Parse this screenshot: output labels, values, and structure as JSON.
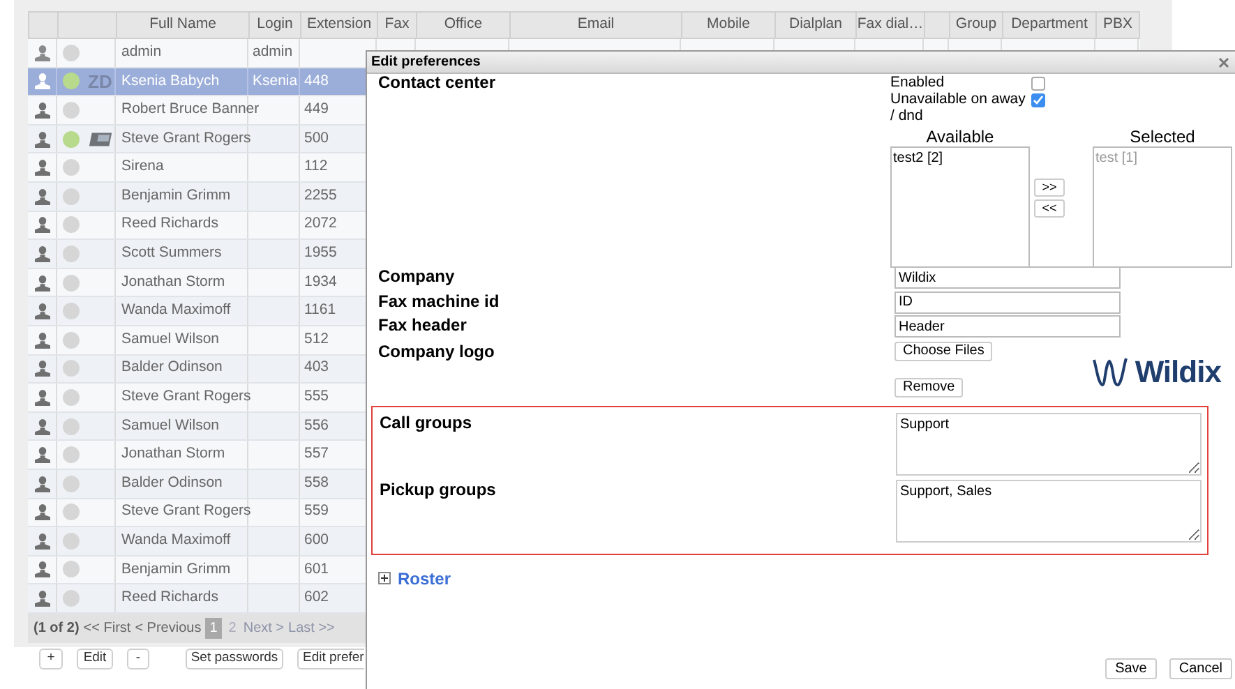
{
  "table": {
    "columns": [
      {
        "kind": "blank"
      },
      {
        "kind": "blank"
      },
      {
        "kind": "text",
        "label": "Full Name"
      },
      {
        "kind": "text",
        "label": "Login"
      },
      {
        "kind": "text",
        "label": "Extension"
      },
      {
        "kind": "text",
        "label": "Fax"
      },
      {
        "kind": "text",
        "label": "Office"
      },
      {
        "kind": "text",
        "label": "Email"
      },
      {
        "kind": "text",
        "label": "Mobile"
      },
      {
        "kind": "text",
        "label": "Dialplan"
      },
      {
        "kind": "text",
        "label": "Fax dial…"
      },
      {
        "kind": "blank"
      },
      {
        "kind": "text",
        "label": "Group"
      },
      {
        "kind": "text",
        "label": "Department"
      },
      {
        "kind": "text",
        "label": "PBX"
      }
    ],
    "rows": [
      {
        "kind": "admin",
        "online": false,
        "name": "admin",
        "login": "admin",
        "selected": false
      },
      {
        "kind": "user",
        "online": true,
        "device": {
          "kind": "text",
          "label": "ZD"
        },
        "name": "Ksenia Babych",
        "login": "Ksenia",
        "extension": "448",
        "selected": true
      },
      {
        "kind": "user",
        "online": false,
        "name": "Robert Bruce Banner",
        "extension": "449",
        "selected": false
      },
      {
        "kind": "user",
        "online": true,
        "device": {
          "kind": "phone"
        },
        "name": "Steve Grant Rogers",
        "extension": "500",
        "selected": false
      },
      {
        "kind": "user",
        "online": false,
        "name": "Sirena",
        "extension": "112",
        "selected": false
      },
      {
        "kind": "user",
        "online": false,
        "name": "Benjamin Grimm",
        "extension": "2255",
        "selected": false
      },
      {
        "kind": "user",
        "online": false,
        "name": "Reed Richards",
        "extension": "2072",
        "selected": false
      },
      {
        "kind": "user",
        "online": false,
        "name": "Scott Summers",
        "extension": "1955",
        "selected": false
      },
      {
        "kind": "user",
        "online": false,
        "name": "Jonathan Storm",
        "extension": "1934",
        "selected": false
      },
      {
        "kind": "user",
        "online": false,
        "name": "Wanda Maximoff",
        "extension": "1161",
        "selected": false
      },
      {
        "kind": "user",
        "online": false,
        "name": "Samuel Wilson",
        "extension": "512",
        "selected": false
      },
      {
        "kind": "user",
        "online": false,
        "name": "Balder Odinson",
        "extension": "403",
        "selected": false
      },
      {
        "kind": "user",
        "online": false,
        "name": "Steve Grant Rogers",
        "extension": "555",
        "selected": false
      },
      {
        "kind": "user",
        "online": false,
        "name": "Samuel Wilson",
        "extension": "556",
        "selected": false
      },
      {
        "kind": "user",
        "online": false,
        "name": "Jonathan Storm",
        "extension": "557",
        "selected": false
      },
      {
        "kind": "user",
        "online": false,
        "name": "Balder Odinson",
        "extension": "558",
        "selected": false
      },
      {
        "kind": "user",
        "online": false,
        "name": "Steve Grant Rogers",
        "extension": "559",
        "selected": false
      },
      {
        "kind": "user",
        "online": false,
        "name": "Wanda Maximoff",
        "extension": "600",
        "selected": false
      },
      {
        "kind": "user",
        "online": false,
        "name": "Benjamin Grimm",
        "extension": "601",
        "selected": false
      },
      {
        "kind": "user",
        "online": false,
        "name": "Reed Richards",
        "extension": "602",
        "selected": false
      }
    ]
  },
  "pager": {
    "summary": "(1 of 2)",
    "first": "<< First",
    "previous": "< Previous",
    "pages": [
      {
        "label": "1",
        "selected": true
      },
      {
        "label": "2",
        "selected": false
      }
    ],
    "next": "Next >",
    "last": "Last >>"
  },
  "actions": [
    "+",
    "Edit",
    "-",
    "Set passwords",
    "Edit prefer"
  ],
  "dialog": {
    "title": "Edit preferences",
    "contact_center": {
      "label": "Contact center",
      "options": [
        {
          "label": "Enabled",
          "checked": false
        },
        {
          "label": "Unavailable on away / dnd",
          "checked": true
        }
      ],
      "available": {
        "heading": "Available",
        "items": [
          "test2 [2]"
        ]
      },
      "selected": {
        "heading": "Selected",
        "items": [
          "test [1]"
        ]
      },
      "move_buttons": [
        ">>",
        "<<"
      ]
    },
    "fields": [
      {
        "label": "Company",
        "value": "Wildix"
      },
      {
        "label": "Fax machine id",
        "value": "ID"
      },
      {
        "label": "Fax header",
        "value": "Header"
      }
    ],
    "logo": {
      "label": "Company logo",
      "choose_button": "Choose Files",
      "remove_button": "Remove",
      "preview_text": "Wildix"
    },
    "groups": [
      {
        "label": "Call groups",
        "value": "Support"
      },
      {
        "label": "Pickup groups",
        "value": "Support, Sales"
      }
    ],
    "roster": {
      "label": "Roster",
      "expanded": false
    },
    "buttons": [
      "Save",
      "Cancel"
    ]
  }
}
